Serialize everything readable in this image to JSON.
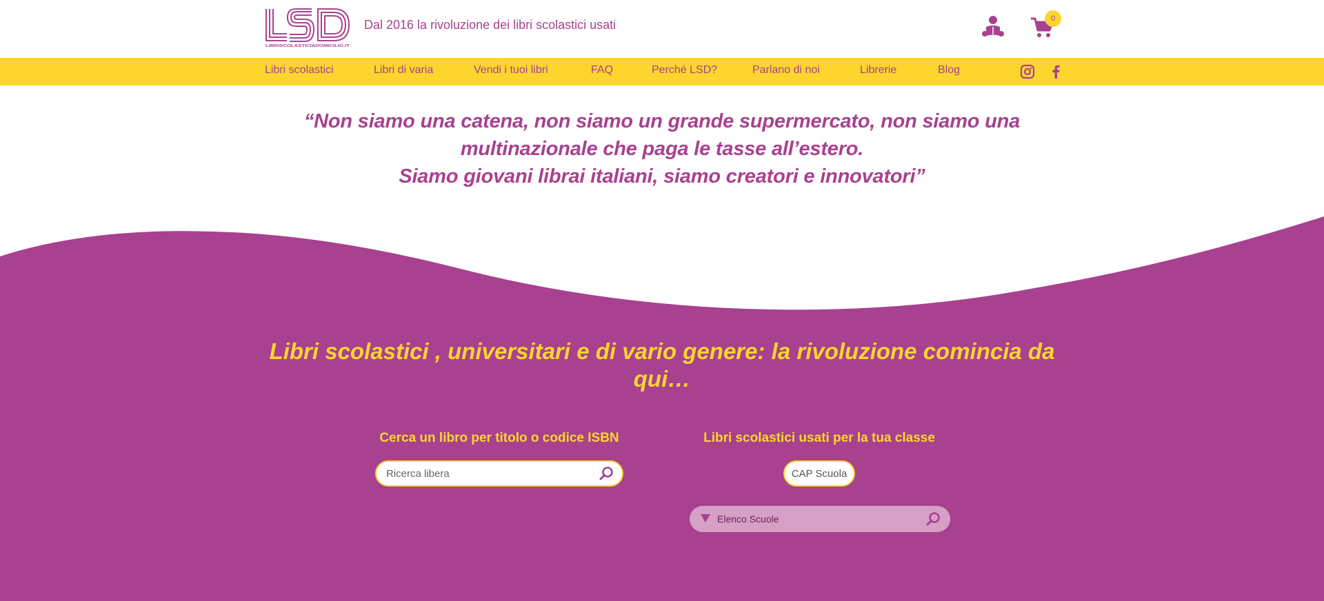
{
  "header": {
    "logo_text": "LSD",
    "logo_subtext": "LIBRISCOLASTICIADOMICILIO.IT",
    "tagline": "Dal 2016 la rivoluzione dei libri scolastici usati",
    "cart_count": "0",
    "icons": [
      "reader-user-icon",
      "cart-icon"
    ]
  },
  "nav": {
    "items": [
      {
        "label": "Libri scolastici"
      },
      {
        "label": "Libri di varia"
      },
      {
        "label": "Vendi i tuoi libri"
      },
      {
        "label": "FAQ"
      },
      {
        "label": "Perché LSD?"
      },
      {
        "label": "Parlano di noi"
      },
      {
        "label": "Librerie"
      },
      {
        "label": "Blog"
      }
    ],
    "social": [
      "instagram-icon",
      "facebook-icon"
    ]
  },
  "quote": {
    "line1": "“Non siamo una catena, non siamo un grande supermercato, non siamo una",
    "line2": "multinazionale che paga le tasse all’estero.",
    "line3": "Siamo giovani librai italiani, siamo creatori e innovatori”"
  },
  "hero": {
    "title_line1": "Libri scolastici , universitari e di vario genere: la rivoluzione comincia da",
    "title_line2": "qui…"
  },
  "search": {
    "title": "Cerca un libro per titolo o codice ISBN",
    "placeholder": "Ricerca libera"
  },
  "class_search": {
    "title": "Libri scolastici usati per la tua classe",
    "cap_placeholder": "CAP Scuola",
    "schools_label": "Elenco Scuole"
  },
  "colors": {
    "brand_purple": "#a8418f",
    "brand_yellow": "#fdd52d",
    "select_bg": "#d59fc6"
  }
}
